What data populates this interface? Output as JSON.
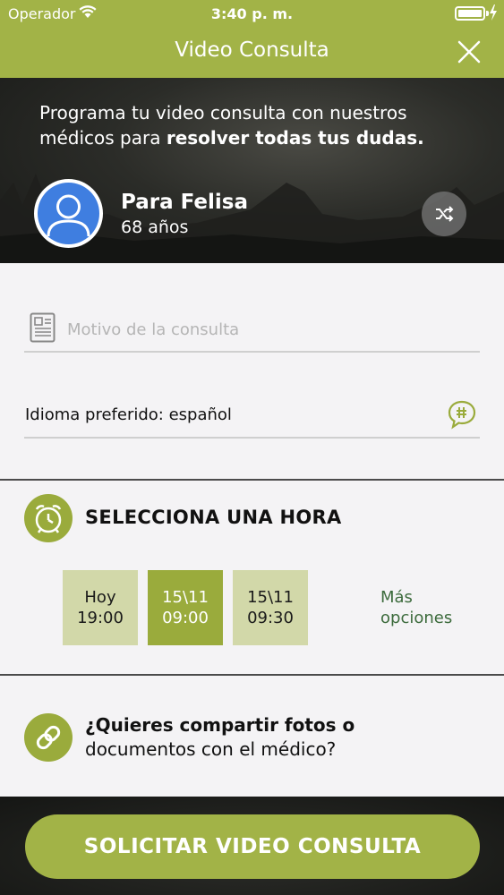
{
  "status_bar": {
    "carrier": "Operador",
    "time": "3:40 p. m."
  },
  "header": {
    "title": "Video Consulta"
  },
  "hero": {
    "intro_plain": "Programa tu video consulta con nuestros médicos para ",
    "intro_bold": "resolver todas tus dudas.",
    "patient_name": "Para Felisa",
    "patient_age": "68 años"
  },
  "form": {
    "motivo_placeholder": "Motivo de la consulta",
    "motivo_value": "",
    "language_label": "Idioma preferido: español"
  },
  "time_selection": {
    "heading": "SELECCIONA UNA HORA",
    "slots": [
      {
        "line1": "Hoy",
        "line2": "19:00",
        "selected": false
      },
      {
        "line1": "15\\11",
        "line2": "09:00",
        "selected": true
      },
      {
        "line1": "15\\11",
        "line2": "09:30",
        "selected": false
      }
    ],
    "more_options_line1": "Más",
    "more_options_line2": "opciones"
  },
  "share": {
    "question_bold": "¿Quieres compartir fotos o",
    "question_rest": "documentos con el médico?"
  },
  "cta": {
    "label": "SOLICITAR VIDEO CONSULTA"
  },
  "colors": {
    "accent": "#a2b347",
    "accent_dark": "#9aab3c",
    "slot_unselected": "#d2d8a9",
    "link_text": "#3c6b3c",
    "avatar_blue": "#3f7ee0"
  },
  "icons": {
    "wifi": "wifi-icon",
    "battery": "battery-icon",
    "close": "close-icon",
    "avatar": "user-avatar-icon",
    "shuffle": "shuffle-icon",
    "motivo": "document-icon",
    "language": "language-icon",
    "clock": "alarm-clock-icon",
    "link": "link-icon"
  }
}
